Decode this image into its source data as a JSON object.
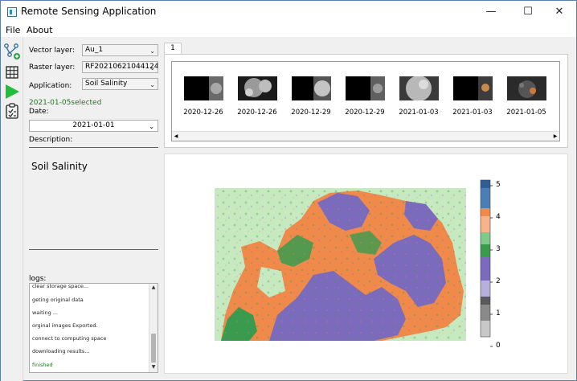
{
  "window": {
    "title": "Remote Sensing Application",
    "controls": {
      "minimize": "—",
      "maximize": "☐",
      "close": "✕"
    }
  },
  "menu": [
    {
      "label": "File"
    },
    {
      "label": "About"
    }
  ],
  "toolbar": [
    "vector-add-icon",
    "grid-icon",
    "play-icon",
    "clipboard-icon"
  ],
  "form": {
    "vector_label": "Vector layer:",
    "vector_value": "Au_1",
    "raster_label": "Raster layer:",
    "raster_value": "RF20210621044124",
    "application_label": "Application:",
    "application_value": "Soil Salinity",
    "selected_text": "2021-01-05selected",
    "date_label": "Date:",
    "date_value": "2021-01-01",
    "description_label": "Description:",
    "description_text": "Soil Salinity"
  },
  "logs": {
    "label": "logs:",
    "lines": [
      "clear storage space...",
      "geting original data",
      "waiting ...",
      "orginal images Exported.",
      "connect to computing space",
      "downloading results...",
      "finished"
    ],
    "finished_color": "#1a7a1a"
  },
  "tabs": [
    {
      "label": "1"
    }
  ],
  "thumbnails": [
    {
      "date": "2020-12-26"
    },
    {
      "date": "2020-12-26"
    },
    {
      "date": "2020-12-29"
    },
    {
      "date": "2020-12-29"
    },
    {
      "date": "2021-01-03"
    },
    {
      "date": "2021-01-03"
    },
    {
      "date": "2021-01-05"
    }
  ],
  "colorbar": {
    "ticks": [
      "5",
      "4",
      "3",
      "2",
      "1",
      "0"
    ],
    "colors": {
      "blue": "#4a7fb5",
      "orange": "#f08a4b",
      "green": "#3a9b4f",
      "purple": "#7c6bbd",
      "gray": "#8a8a8a",
      "light_green": "#c7e9c0"
    }
  }
}
